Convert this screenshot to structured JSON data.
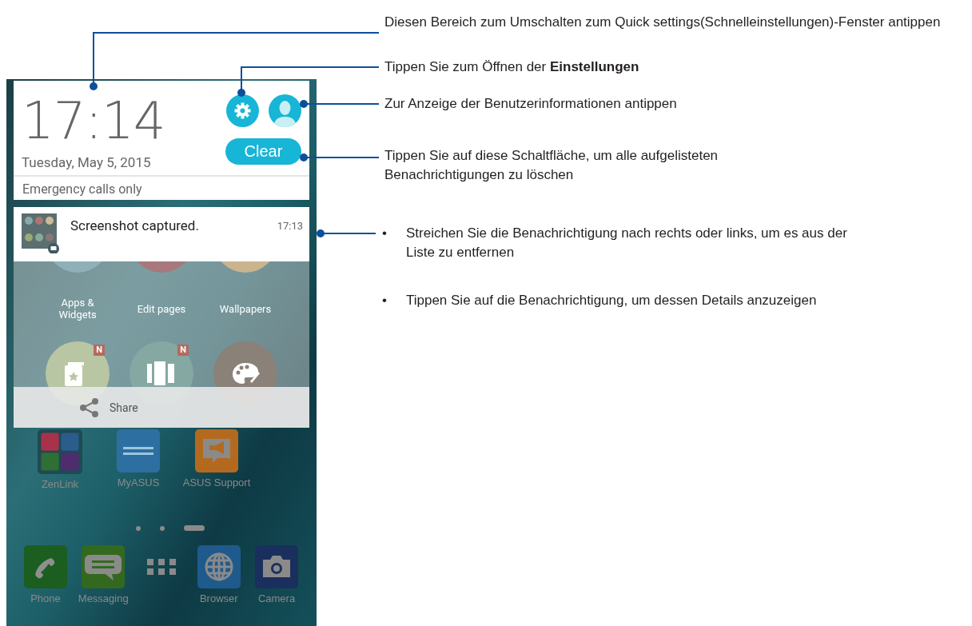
{
  "phone": {
    "clock": "17:14",
    "date": "Tuesday, May 5, 2015",
    "clear_button": "Clear",
    "status": "Emergency calls only",
    "notification": {
      "title": "Screenshot captured.",
      "time": "17:13"
    },
    "menu_items": [
      {
        "kind": "apps",
        "label": "Apps & Widgets",
        "color": "#8fb0b8"
      },
      {
        "kind": "pages",
        "label": "Edit pages",
        "color": "#a8787c"
      },
      {
        "kind": "wallpapers",
        "label": "Wallpapers",
        "color": "#c9b48e"
      },
      {
        "kind": "icon-packs",
        "badge": "N",
        "color": "#b9c6a4"
      },
      {
        "kind": "scroll",
        "badge": "N",
        "color": "#86a8a2"
      },
      {
        "kind": "themes",
        "color": "#8a8178"
      }
    ],
    "share": "Share",
    "apps": [
      {
        "kind": "folder",
        "label": "ZenLink"
      },
      {
        "kind": "myasus",
        "label": "MyASUS"
      },
      {
        "kind": "support",
        "label": "ASUS Support"
      }
    ],
    "page_dots": [
      {
        "selected": false
      },
      {
        "selected": false
      },
      {
        "selected": true
      }
    ],
    "dock": [
      {
        "kind": "phone",
        "label": "Phone"
      },
      {
        "kind": "messaging",
        "label": "Messaging"
      },
      {
        "kind": "all-apps"
      },
      {
        "kind": "browser",
        "label": "Browser"
      },
      {
        "kind": "camera",
        "label": "Camera"
      }
    ]
  },
  "callouts": [
    {
      "text": "Diesen Bereich zum Umschalten zum Quick settings(Schnelleinstellungen)-Fenster antippen"
    },
    {
      "text": "Tippen Sie zum Öffnen der **Einstellungen**"
    },
    {
      "text": "Zur Anzeige der Benutzerinformationen antippen"
    },
    {
      "text": "Tippen Sie auf diese Schaltfläche, um alle aufgelisteten Benachrichtigungen zu löschen"
    },
    {
      "bullet": "•",
      "text": "Streichen Sie die Benachrichtigung nach rechts oder links, um es aus der Liste zu entfernen"
    },
    {
      "bullet": "•",
      "text": "Tippen Sie auf die Benachrichtigung, um dessen Details anzuzeigen"
    }
  ]
}
